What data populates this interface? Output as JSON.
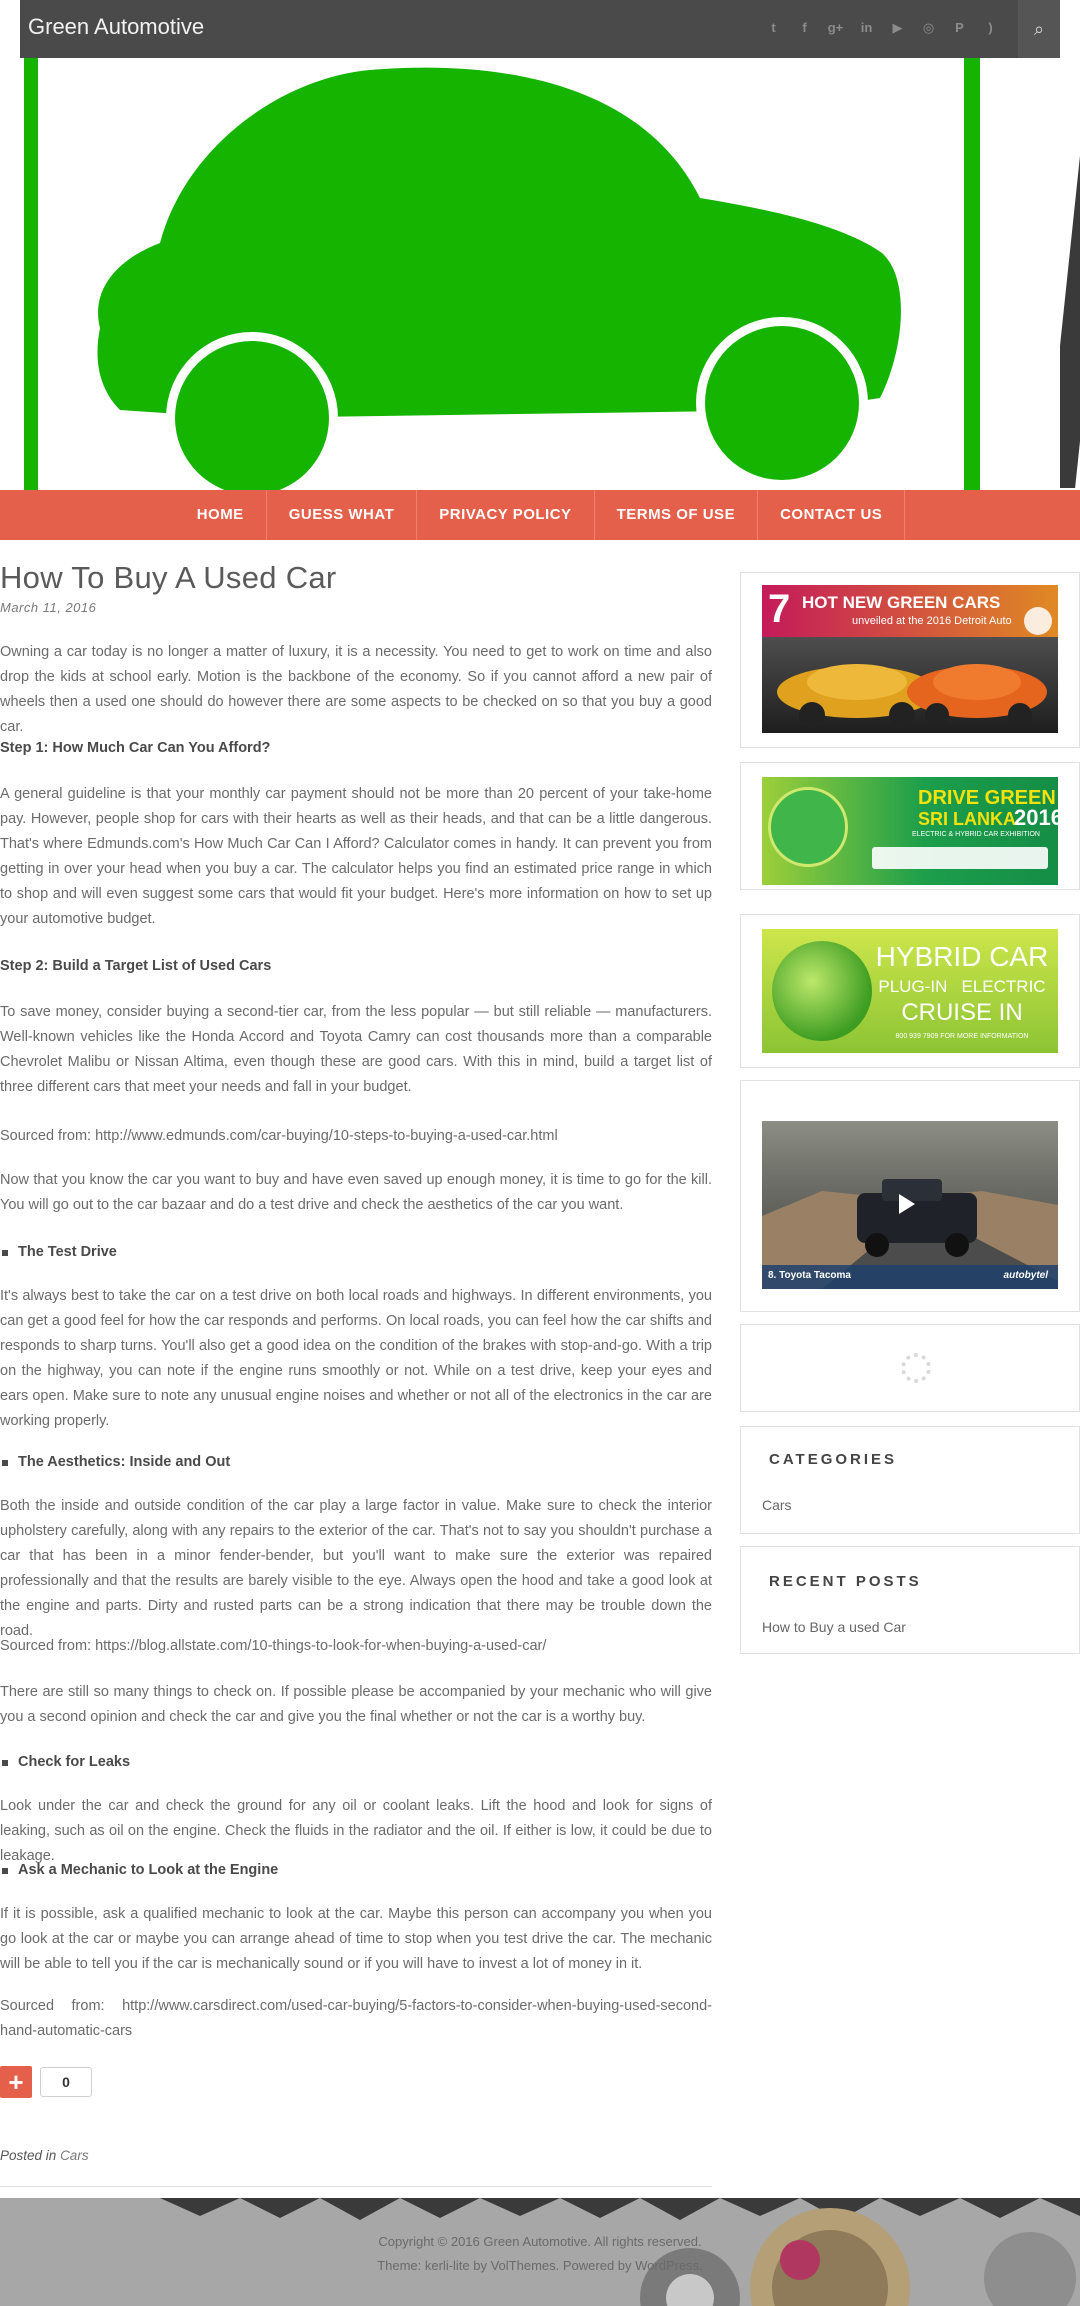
{
  "site": {
    "title": "Green Automotive"
  },
  "social": {
    "icons": [
      "twitter-icon",
      "facebook-icon",
      "google-plus-icon",
      "linkedin-icon",
      "youtube-icon",
      "instagram-icon",
      "pinterest-icon",
      "rss-icon"
    ],
    "glyphs": [
      "t",
      "f",
      "g+",
      "in",
      "▶",
      "◎",
      "P",
      ")"
    ]
  },
  "search": {
    "glyph": "⌕"
  },
  "colors": {
    "brand_green": "#15b400",
    "nav_accent": "#e4604a",
    "topbar": "#4a4a4a"
  },
  "nav": {
    "items": [
      "HOME",
      "GUESS WHAT",
      "PRIVACY POLICY",
      "TERMS OF USE",
      "CONTACT US"
    ]
  },
  "post": {
    "title": "How To Buy A Used Car",
    "date": "March 11, 2016",
    "intro": "Owning a car today is no longer a matter of luxury, it is a necessity. You need to get to work on time and also drop the kids at school early. Motion is the backbone of the economy. So if you cannot afford a new pair of wheels then a used one should do however there are some aspects to be checked on so that you buy a good car.",
    "step1_heading": "Step 1: How Much Car Can You Afford?",
    "step1_text": "A general guideline is that your monthly car payment should not be more than 20 percent of your take-home pay. However, people shop for cars with their hearts as well as their heads, and that can be a little dangerous. That's where Edmunds.com's How Much Car Can I Afford? Calculator comes in handy. It can prevent you from getting in over your head when you buy a car. The calculator helps you find an estimated price range in which to shop and will even suggest some cars that would fit your budget. Here's more information on how to set up your automotive budget.",
    "step2_heading": "Step 2: Build a Target List of Used Cars",
    "step2_text": "To save money, consider buying a second-tier car, from the less popular — but still reliable — manufacturers. Well-known vehicles like the Honda Accord and Toyota Camry can cost thousands more than a comparable Chevrolet Malibu or Nissan Altima, even though these are good cars. With this in mind, build a target list of three different cars that meet your needs and fall in your budget.",
    "source1": "Sourced from: http://www.edmunds.com/car-buying/10-steps-to-buying-a-used-car.html",
    "transition": "Now that you know the car you want to buy and have even saved up enough money, it is time to go for the kill. You will go out to the car bazaar and do a test drive and check the aesthetics of the car you want.",
    "test_drive_heading": "The Test Drive",
    "test_drive_text": "It's always best to take the car on a test drive on both local roads and highways. In different environments, you can get a good feel for how the car responds and performs. On local roads, you can feel how the car shifts and responds to sharp turns. You'll also get a good idea on the condition of the brakes with stop-and-go. With a trip on the highway, you can note if the engine runs smoothly or not. While on a test drive, keep your eyes and ears open. Make sure to note any unusual engine noises and whether or not all of the electronics in the car are working properly.",
    "aesthetics_heading": "The Aesthetics: Inside and Out",
    "aesthetics_text": "Both the inside and outside condition of the car play a large factor in value. Make sure to check the interior upholstery carefully, along with any repairs to the exterior of the car. That's not to say you shouldn't purchase a car that has been in a minor fender-bender, but you'll want to make sure the exterior was repaired professionally and that the results are barely visible to the eye. Always open the hood and take a good look at the engine and parts. Dirty and rusted parts can be a strong indication that there may be trouble down the road.",
    "source2": "Sourced from: https://blog.allstate.com/10-things-to-look-for-when-buying-a-used-car/",
    "mechanic_note": "There are still so many things to check on. If possible please be accompanied by your mechanic who will give you a second opinion and check the car and give you the final whether or not the car is a worthy buy.",
    "leaks_heading": "Check for Leaks",
    "leaks_text": "Look under the car and check the ground for any oil or coolant leaks. Lift the hood and look for signs of leaking, such as oil on the engine. Check the fluids in the radiator and the oil. If either is low, it could be due to leakage.",
    "engine_heading": "Ask a Mechanic to Look at the Engine",
    "engine_text": "If it is possible, ask a qualified mechanic to look at the car. Maybe this person can accompany you when you go look at the car or maybe you can arrange ahead of time to stop when you test drive the car. The mechanic will be able to tell you if the car is mechanically sound or if you will have to invest a lot of money in it.",
    "source3": "Sourced from: http://www.carsdirect.com/used-car-buying/5-factors-to-consider-when-buying-used-second-hand-automatic-cars",
    "share_count": "0",
    "posted_in_label": "Posted in",
    "posted_in_category": "Cars"
  },
  "sidebar": {
    "ad1": {
      "number": "7",
      "title": "HOT NEW GREEN CARS",
      "subtitle": "unveiled at the 2016 Detroit Auto"
    },
    "ad2": {
      "title": "DRIVE GREEN",
      "subtitle": "SRI LANKA",
      "year": "2016",
      "tagline": "ELECTRIC & HYBRID CAR EXHIBITION"
    },
    "ad3": {
      "line1": "HYBRID CAR",
      "line2": "PLUG-IN   ELECTRIC",
      "line3": "CRUISE IN",
      "line4": "800 939 7909 FOR MORE INFORMATION"
    },
    "video": {
      "caption": "8. Toyota Tacoma",
      "brand": "autobytel"
    },
    "categories_title": "CATEGORIES",
    "categories": [
      "Cars"
    ],
    "recent_title": "RECENT POSTS",
    "recent": [
      "How to Buy a used Car"
    ]
  },
  "footer": {
    "copyright": "Copyright © 2016 Green Automotive. All rights reserved.",
    "credit": "Theme: kerli-lite by VolThemes. Powered by WordPress."
  }
}
